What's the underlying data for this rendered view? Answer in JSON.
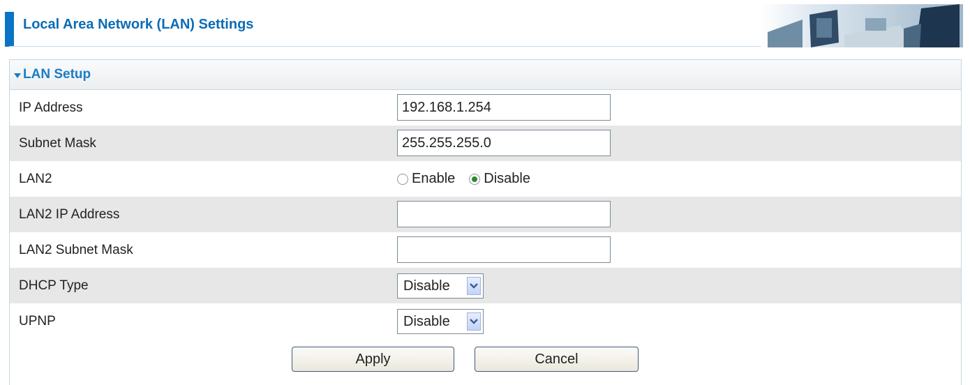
{
  "header": {
    "title": "Local Area Network (LAN) Settings"
  },
  "panel": {
    "title": "LAN Setup",
    "rows": [
      {
        "label": "IP Address",
        "value": "192.168.1.254"
      },
      {
        "label": "Subnet Mask",
        "value": "255.255.255.0"
      },
      {
        "label": "LAN2",
        "options": [
          "Enable",
          "Disable"
        ],
        "selected": "Disable"
      },
      {
        "label": "LAN2 IP Address",
        "value": ""
      },
      {
        "label": "LAN2 Subnet Mask",
        "value": ""
      },
      {
        "label": "DHCP Type",
        "value": "Disable"
      },
      {
        "label": "UPNP",
        "value": "Disable"
      }
    ]
  },
  "buttons": {
    "apply": "Apply",
    "cancel": "Cancel"
  },
  "colors": {
    "accent": "#0b73c6",
    "title": "#1a7cc4",
    "row_alt": "#e7e7e7"
  }
}
